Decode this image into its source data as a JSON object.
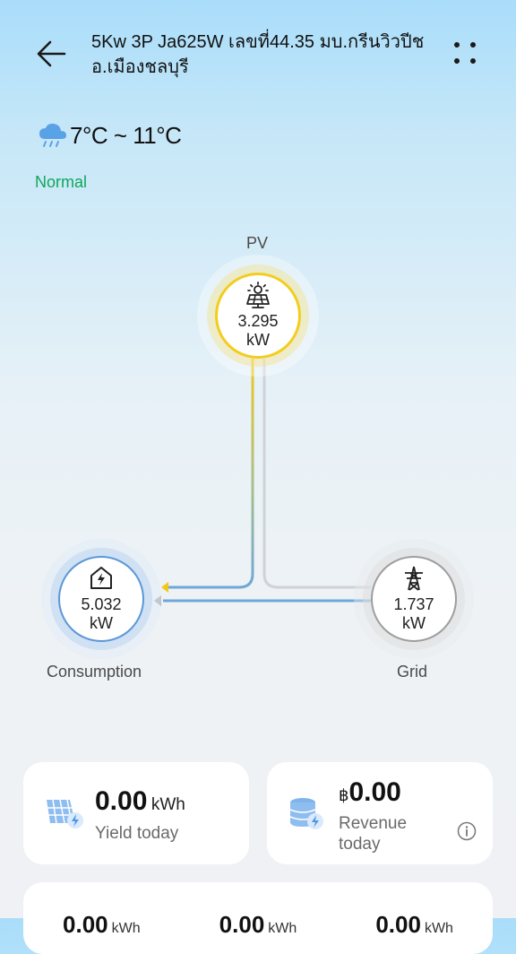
{
  "header": {
    "title": "5Kw 3P Ja625W เลขที่44.35 มบ.กรีนวิวปีช  อ.เมืองชลบุรี"
  },
  "weather": {
    "icon": "rain-cloud-icon",
    "temperature": "7°C ~ 11°C"
  },
  "status": {
    "text": "Normal",
    "color": "#10a65a"
  },
  "flow": {
    "pv": {
      "label": "PV",
      "value": "3.295",
      "unit": "kW",
      "icon": "solar-panel-icon",
      "color": "#f3cd1d"
    },
    "consumption": {
      "label": "Consumption",
      "value": "5.032",
      "unit": "kW",
      "icon": "house-icon",
      "color": "#5b97d8"
    },
    "grid": {
      "label": "Grid",
      "value": "1.737",
      "unit": "kW",
      "icon": "power-tower-icon",
      "color": "#9e9e9e"
    }
  },
  "cards": {
    "yield": {
      "value": "0.00",
      "unit": "kWh",
      "label": "Yield today",
      "icon": "solar-panel-bolt-icon"
    },
    "revenue": {
      "currency": "฿",
      "value": "0.00",
      "label": "Revenue today",
      "icon": "coin-stack-icon",
      "info_icon": "info-icon"
    }
  },
  "bottom_card": {
    "values": [
      {
        "value": "0.00",
        "unit": "kWh"
      },
      {
        "value": "0.00",
        "unit": "kWh"
      },
      {
        "value": "0.00",
        "unit": "kWh"
      }
    ]
  }
}
